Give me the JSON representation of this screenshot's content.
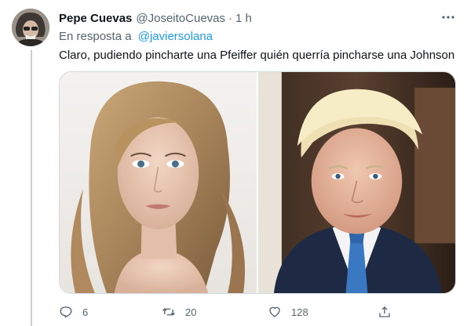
{
  "tweet": {
    "author_name": "Pepe Cuevas",
    "author_handle": "@JoseitoCuevas",
    "separator": "·",
    "time": "1 h",
    "reply_prefix": "En resposta a",
    "reply_mention": "@javiersolana",
    "text": "Claro, pudiendo pincharte una Pfeiffer quién querría pincharse una Johnson"
  },
  "actions": {
    "reply_count": "6",
    "retweet_count": "20",
    "like_count": "128"
  },
  "icons": {
    "more": "more-dots-icon",
    "reply": "reply-bubble-icon",
    "retweet": "retweet-icon",
    "like": "heart-icon",
    "share": "share-icon"
  },
  "colors": {
    "text": "#0f1419",
    "secondary": "#536471",
    "link": "#1d9bf0",
    "border": "#cfd9de"
  }
}
